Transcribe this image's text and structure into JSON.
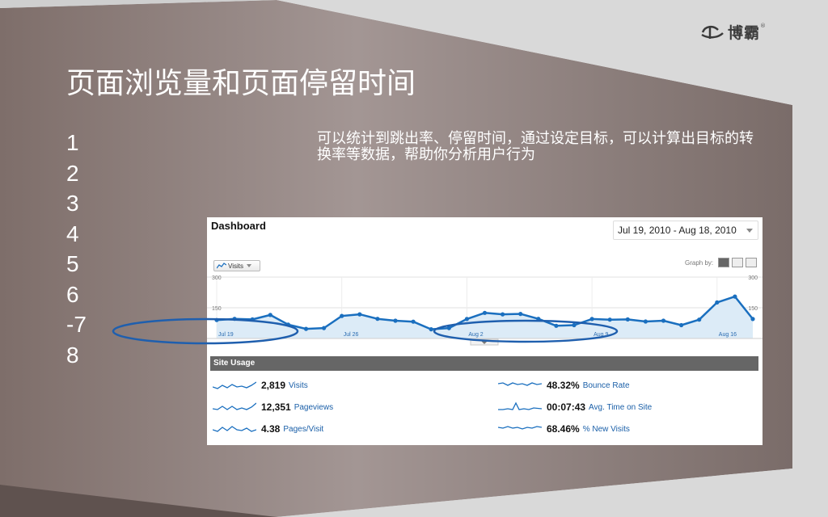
{
  "slide": {
    "title": "页面浏览量和页面停留时间",
    "logo_text": "博霸",
    "logo_mark": "®",
    "list_items": [
      "1",
      "2",
      "3",
      "4",
      "5",
      "6",
      "-7",
      "8"
    ],
    "description": "可以统计到跳出率、停留时间，通过设定目标，可以计算出目标的转换率等数据，帮助你分析用户行为"
  },
  "dashboard": {
    "title": "Dashboard",
    "date_range": "Jul 19, 2010 - Aug 18, 2010",
    "metric_selector": "Visits",
    "graph_by_label": "Graph by:",
    "section_title": "Site Usage",
    "metrics_left": [
      {
        "value": "2,819",
        "label": "Visits",
        "icon": "sparkline-icon"
      },
      {
        "value": "12,351",
        "label": "Pageviews",
        "icon": "sparkline-icon"
      },
      {
        "value": "4.38",
        "label": "Pages/Visit",
        "icon": "sparkline-icon"
      }
    ],
    "metrics_right": [
      {
        "value": "48.32%",
        "label": "Bounce Rate",
        "icon": "sparkline-icon"
      },
      {
        "value": "00:07:43",
        "label": "Avg. Time on Site",
        "icon": "sparkline-icon"
      },
      {
        "value": "68.46%",
        "label": "% New Visits",
        "icon": "sparkline-icon"
      }
    ],
    "colors": {
      "line": "#1a6fbf",
      "fill": "#dcebf7",
      "header": "#666666",
      "link": "#1a5fa8"
    }
  },
  "chart_data": {
    "type": "area",
    "series": [
      {
        "name": "Visits",
        "values": [
          90,
          96,
          93,
          115,
          68,
          47,
          51,
          110,
          118,
          96,
          87,
          82,
          45,
          51,
          95,
          125,
          118,
          120,
          96,
          62,
          65,
          95,
          92,
          93,
          83,
          87,
          65,
          92,
          176,
          205,
          95
        ]
      }
    ],
    "x_tick_labels": [
      "Jul 19",
      "Jul 26",
      "Aug 2",
      "Aug 9",
      "Aug 16"
    ],
    "y_tick_labels": [
      "300",
      "150"
    ],
    "ylim": [
      0,
      300
    ],
    "grid": true
  }
}
